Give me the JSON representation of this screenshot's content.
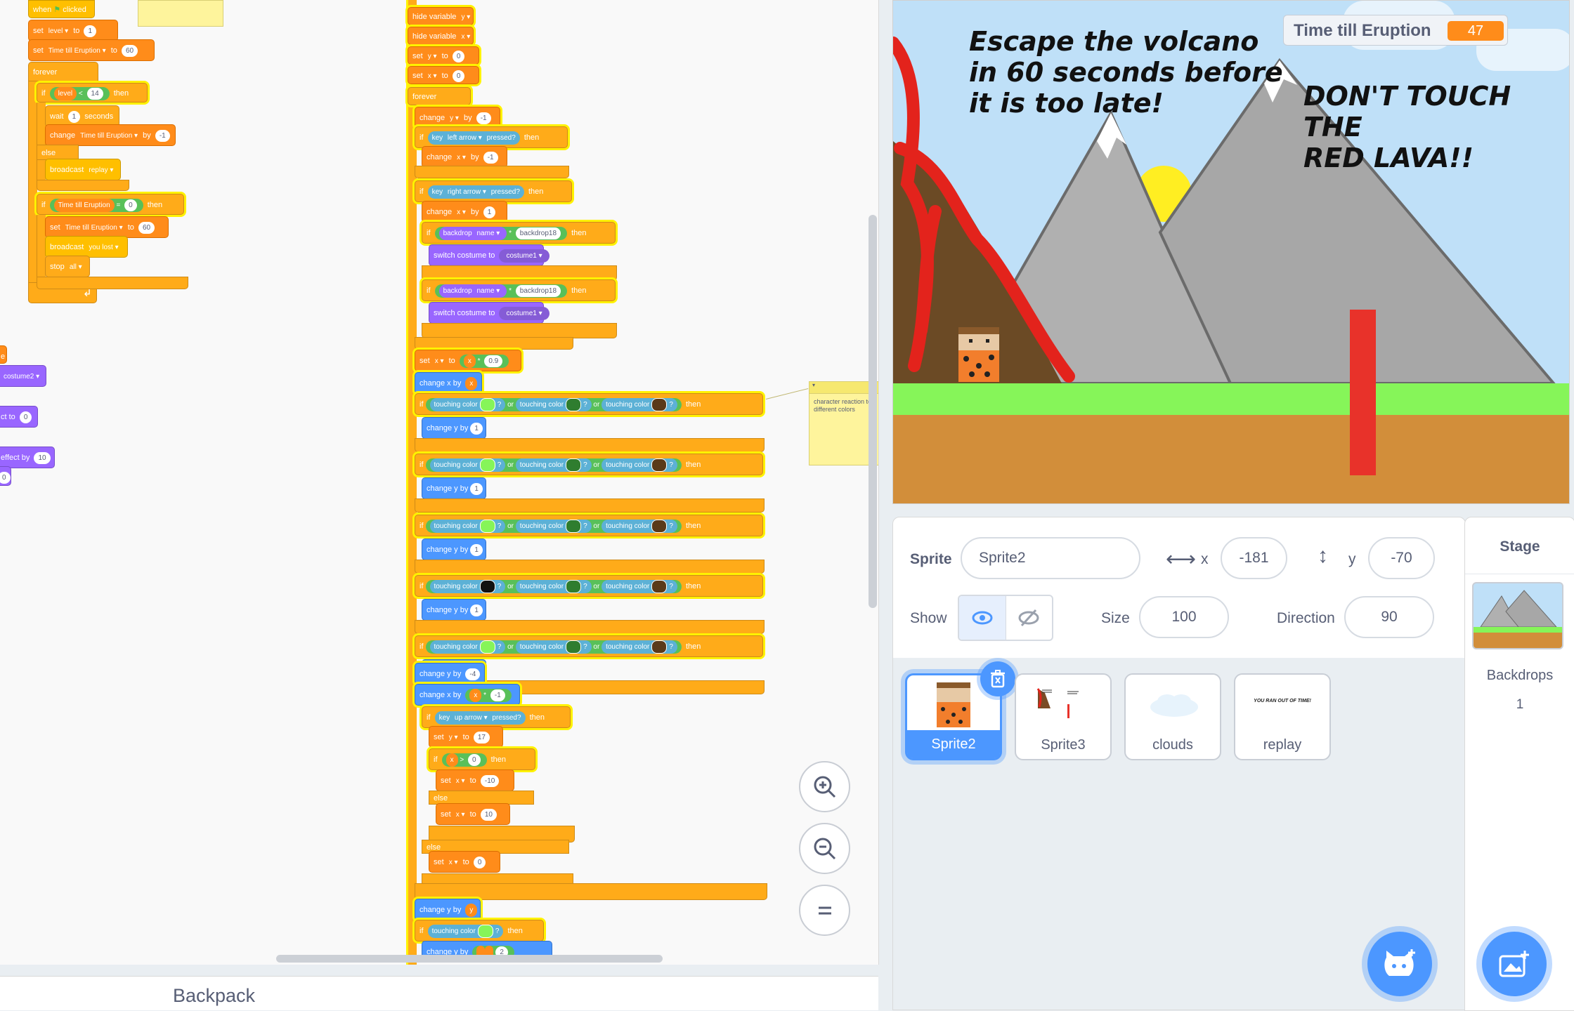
{
  "code": {
    "left_script": {
      "hat_label": "when",
      "hat_suffix": "clicked",
      "set_word": "set",
      "to_word": "to",
      "by_word": "by",
      "level_var": "level",
      "level_init": "1",
      "time_var": "Time till Eruption",
      "time_init": "60",
      "forever": "forever",
      "if_word": "if",
      "then_word": "then",
      "else_word": "else",
      "lt": "<",
      "eq": "=",
      "level_limit": "14",
      "wait_word": "wait",
      "wait_val": "1",
      "seconds_word": "seconds",
      "change_word": "change",
      "change_val": "-1",
      "broadcast_word": "broadcast",
      "replay_msg": "replay",
      "zero": "0",
      "reset_val": "60",
      "youlost_msg": "you lost",
      "stop_word": "stop",
      "stop_opt": "all"
    },
    "partial_script": {
      "hint": "e",
      "costume2": "costume2",
      "effect_to": "ct to",
      "effect_to_val": "0",
      "effect_by": "effect by",
      "effect_by_val": "10",
      "last_val": "0"
    },
    "main_script": {
      "hide_y": "hide variable",
      "var_y": "y",
      "var_x": "x",
      "set": "set",
      "to": "to",
      "zero": "0",
      "forever": "forever",
      "change": "change",
      "by": "by",
      "minus1": "-1",
      "plus1": "1",
      "if": "if",
      "then": "then",
      "else": "else",
      "key": "key",
      "left_arrow": "left arrow",
      "right_arrow": "right arrow",
      "up_arrow": "up arrow",
      "pressed": "pressed?",
      "backdrop": "backdrop",
      "name": "name",
      "backdrop18": "backdrop18",
      "switch_costume": "switch costume to",
      "costume1": "costume1",
      "times": "*",
      "friction": "0.9",
      "change_x_by": "change x by",
      "change_y_by": "change y by",
      "touching_color": "touching color",
      "q": "?",
      "or": "or",
      "one": "1",
      "minus4": "-4",
      "set17": "17",
      "gt": ">",
      "minus10": "-10",
      "ten": "10",
      "change_y_by_y": "change y by",
      "mul_minus1": "-1",
      "cut_label": "change y by",
      "cut_val": "2"
    },
    "comment_text": "character reaction to different colors",
    "backpack_label": "Backpack"
  },
  "stage": {
    "title_text_lines": [
      "Escape the volcano",
      "in 60 seconds before",
      "it is too late!"
    ],
    "warning_lines": [
      "DON'T TOUCH THE",
      "RED LAVA!!"
    ],
    "monitor_label": "Time till Eruption",
    "monitor_value": "47"
  },
  "sprite_info": {
    "sprite_label": "Sprite",
    "sprite_name": "Sprite2",
    "x_label": "x",
    "x_value": "-181",
    "y_label": "y",
    "y_value": "-70",
    "show_label": "Show",
    "size_label": "Size",
    "size_value": "100",
    "direction_label": "Direction",
    "direction_value": "90"
  },
  "sprites": [
    {
      "name": "Sprite2",
      "selected": true
    },
    {
      "name": "Sprite3",
      "selected": false
    },
    {
      "name": "clouds",
      "selected": false
    },
    {
      "name": "replay",
      "selected": false
    }
  ],
  "replay_thumb_text": "YOU RAN OUT OF TIME!",
  "stage_pane": {
    "title": "Stage",
    "backdrops_label": "Backdrops",
    "backdrops_count": "1"
  },
  "colors": {
    "accent": "#4c97ff",
    "lava": "#e8322a",
    "ground": "#d28e3a",
    "grass": "#86f559",
    "sky": "#bfe0f8"
  }
}
